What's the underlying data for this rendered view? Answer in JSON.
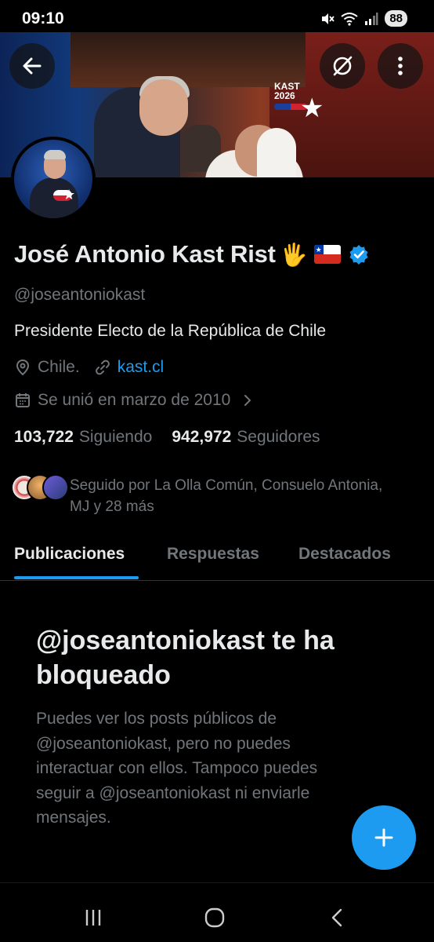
{
  "status_bar": {
    "time": "09:10",
    "battery": "88",
    "icons": [
      "mute-icon",
      "wifi-icon",
      "signal-icon",
      "battery-icon"
    ]
  },
  "banner": {
    "logo_text": "KAST",
    "logo_year": "2026"
  },
  "top_actions": [
    "back-arrow-icon",
    "grok-icon",
    "more-vertical-icon"
  ],
  "profile": {
    "name": "José Antonio Kast Rist",
    "name_emoji": "🖐",
    "handle": "@joseantoniokast",
    "bio": "Presidente Electo de la República de Chile",
    "location": "Chile.",
    "website": "kast.cl",
    "joined": "Se unió en marzo de 2010",
    "following_count": "103,722",
    "following_label": "Siguiendo",
    "followers_count": "942,972",
    "followers_label": "Seguidores",
    "followed_by": "Seguido por La Olla Común, Consuelo Antonia, MJ y 28 más",
    "accent": "#1d9bf0"
  },
  "tabs": [
    {
      "label": "Publicaciones",
      "active": true
    },
    {
      "label": "Respuestas",
      "active": false
    },
    {
      "label": "Destacados",
      "active": false
    }
  ],
  "blocked": {
    "title": "@joseantoniokast te ha bloqueado",
    "description": "Puedes ver los posts públicos de @joseantoniokast, pero no puedes interactuar con ellos. Tampoco puedes seguir a @joseantoniokast ni enviarle mensajes."
  },
  "fab": {
    "icon": "plus-icon"
  },
  "nav_bar": [
    "recents-icon",
    "home-icon",
    "back-icon"
  ]
}
